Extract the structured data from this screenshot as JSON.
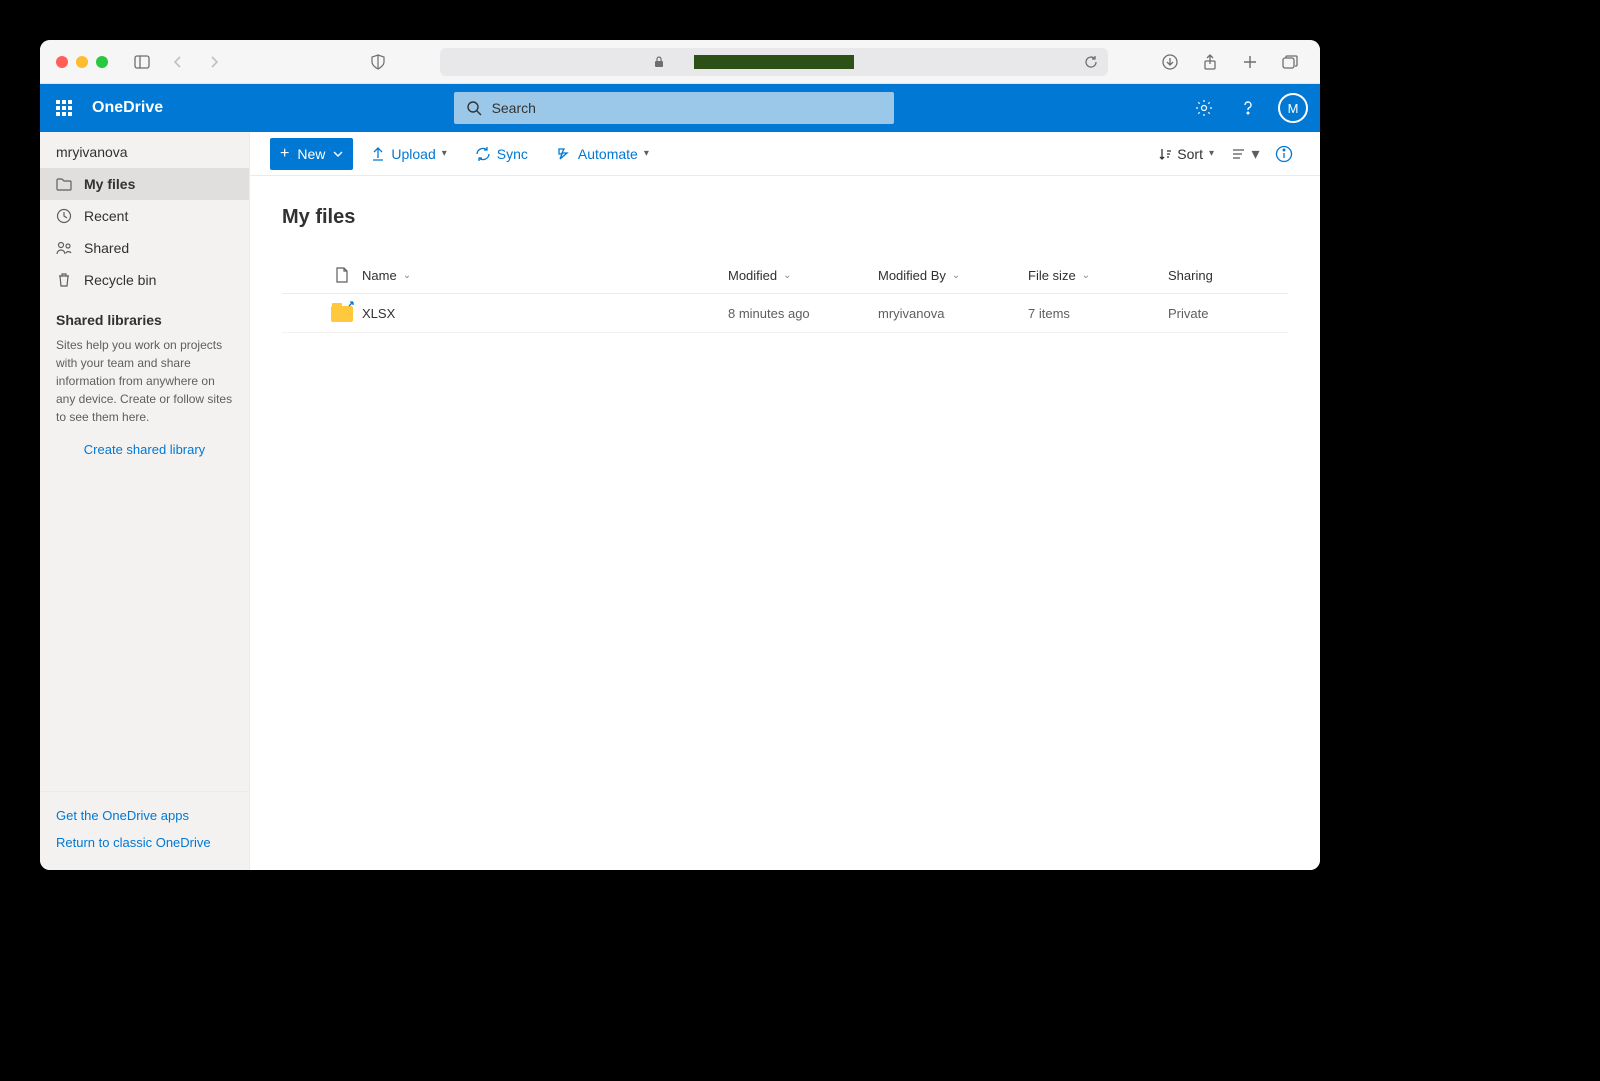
{
  "browser": {
    "url_redacted": true
  },
  "header": {
    "brand": "OneDrive",
    "search_placeholder": "Search",
    "avatar_initial": "M"
  },
  "sidebar": {
    "username": "mryivanova",
    "items": [
      {
        "label": "My files",
        "icon": "folder"
      },
      {
        "label": "Recent",
        "icon": "clock"
      },
      {
        "label": "Shared",
        "icon": "people"
      },
      {
        "label": "Recycle bin",
        "icon": "trash"
      }
    ],
    "section_title": "Shared libraries",
    "section_text": "Sites help you work on projects with your team and share information from anywhere on any device. Create or follow sites to see them here.",
    "create_link": "Create shared library",
    "footer_links": [
      "Get the OneDrive apps",
      "Return to classic OneDrive"
    ]
  },
  "toolbar": {
    "new_label": "New",
    "upload_label": "Upload",
    "sync_label": "Sync",
    "automate_label": "Automate",
    "sort_label": "Sort"
  },
  "content": {
    "title": "My files",
    "columns": {
      "name": "Name",
      "modified": "Modified",
      "modified_by": "Modified By",
      "file_size": "File size",
      "sharing": "Sharing"
    },
    "rows": [
      {
        "name": "XLSX",
        "modified": "8 minutes ago",
        "modified_by": "mryivanova",
        "file_size": "7 items",
        "sharing": "Private"
      }
    ]
  }
}
